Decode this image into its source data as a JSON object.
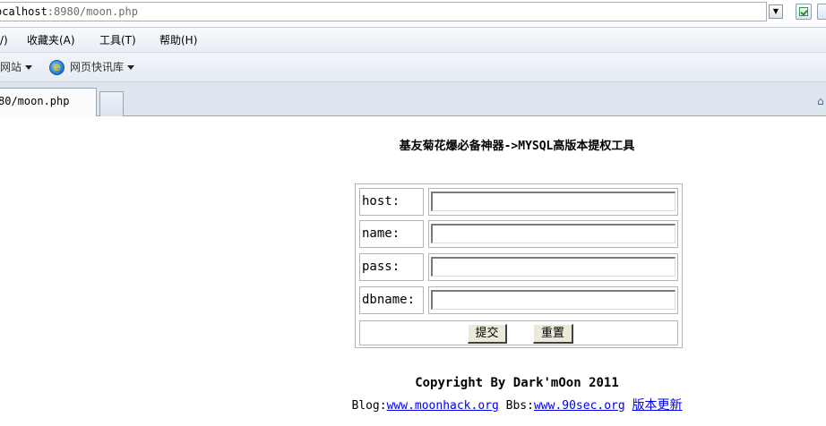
{
  "browser": {
    "address_host": "ocalhost",
    "address_rest": ":8980/moon.php",
    "menu": {
      "view_tail": "/)",
      "favorites": "收藏夹(A)",
      "tools": "工具(T)",
      "help": "帮助(H)"
    },
    "favorites_bar": {
      "sites": "网站",
      "webslice": "网页快讯库"
    },
    "tab": {
      "title": "80/moon.php"
    }
  },
  "page": {
    "title": "基友菊花爆必备神器->MYSQL高版本提权工具",
    "form": {
      "fields": [
        {
          "label": "host:",
          "value": ""
        },
        {
          "label": "name:",
          "value": ""
        },
        {
          "label": "pass:",
          "value": ""
        },
        {
          "label": "dbname:",
          "value": ""
        }
      ],
      "submit_label": "提交",
      "reset_label": "重置"
    },
    "copyright": "Copyright By Dark'mOon 2011",
    "footer": {
      "blog_label": "Blog:",
      "blog_link": "www.moonhack.org",
      "bbs_label": "Bbs:",
      "bbs_link": "www.90sec.org",
      "update_link": "版本更新"
    }
  }
}
